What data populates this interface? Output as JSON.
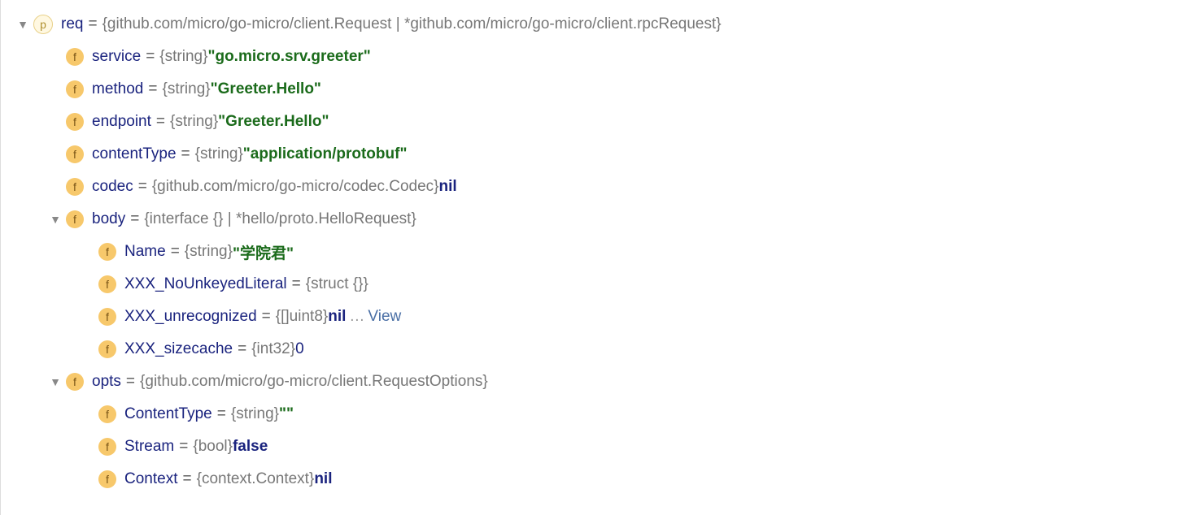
{
  "rows": [
    {
      "level": 0,
      "arrow": "▼",
      "badge": "p",
      "name": "req",
      "type": "{github.com/micro/go-micro/client.Request | *github.com/micro/go-micro/client.rpcRequest}"
    },
    {
      "level": 1,
      "arrow": "",
      "badge": "f",
      "name": "service",
      "type": "{string}",
      "value": "\"go.micro.srv.greeter\"",
      "valueClass": "strval"
    },
    {
      "level": 1,
      "arrow": "",
      "badge": "f",
      "name": "method",
      "type": "{string}",
      "value": "\"Greeter.Hello\"",
      "valueClass": "strval"
    },
    {
      "level": 1,
      "arrow": "",
      "badge": "f",
      "name": "endpoint",
      "type": "{string}",
      "value": "\"Greeter.Hello\"",
      "valueClass": "strval"
    },
    {
      "level": 1,
      "arrow": "",
      "badge": "f",
      "name": "contentType",
      "type": "{string}",
      "value": "\"application/protobuf\"",
      "valueClass": "strval"
    },
    {
      "level": 1,
      "arrow": "",
      "badge": "f",
      "name": "codec",
      "type": "{github.com/micro/go-micro/codec.Codec}",
      "value": "nil",
      "valueClass": "keyword"
    },
    {
      "level": 1,
      "arrow": "▼",
      "badge": "f",
      "name": "body",
      "type": "{interface {} | *hello/proto.HelloRequest}"
    },
    {
      "level": 2,
      "arrow": "",
      "badge": "f",
      "name": "Name",
      "type": "{string}",
      "value": "\"学院君\"",
      "valueClass": "strval"
    },
    {
      "level": 2,
      "arrow": "",
      "badge": "f",
      "name": "XXX_NoUnkeyedLiteral",
      "type": "{struct {}}"
    },
    {
      "level": 2,
      "arrow": "",
      "badge": "f",
      "name": "XXX_unrecognized",
      "type": "{[]uint8}",
      "value": "nil",
      "valueClass": "keyword",
      "extra": "View"
    },
    {
      "level": 2,
      "arrow": "",
      "badge": "f",
      "name": "XXX_sizecache",
      "type": "{int32}",
      "value": "0",
      "valueClass": "numval"
    },
    {
      "level": 1,
      "arrow": "▼",
      "badge": "f",
      "name": "opts",
      "type": "{github.com/micro/go-micro/client.RequestOptions}"
    },
    {
      "level": 2,
      "arrow": "",
      "badge": "f",
      "name": "ContentType",
      "type": "{string}",
      "value": "\"\"",
      "valueClass": "strval"
    },
    {
      "level": 2,
      "arrow": "",
      "badge": "f",
      "name": "Stream",
      "type": "{bool}",
      "value": "false",
      "valueClass": "keyword"
    },
    {
      "level": 2,
      "arrow": "",
      "badge": "f",
      "name": "Context",
      "type": "{context.Context}",
      "value": "nil",
      "valueClass": "keyword"
    }
  ]
}
